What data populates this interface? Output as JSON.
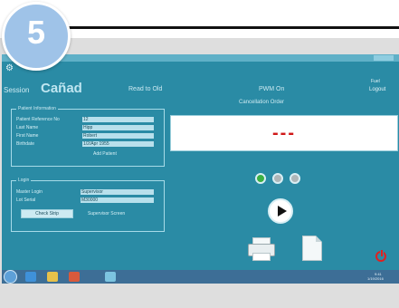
{
  "step": {
    "number": "5"
  },
  "app": {
    "title": "Cañad",
    "session_label": "Session",
    "header_center": "Read to Old",
    "header_right": "PWM On",
    "header_sub": "Cancellation Order",
    "logout_top": "Fuel",
    "logout_label": "Logout"
  },
  "patient_panel": {
    "title": "Patient Information",
    "fields": [
      {
        "label": "Patient Reference No",
        "value": "12"
      },
      {
        "label": "Last Name",
        "value": "Hipp"
      },
      {
        "label": "First Name",
        "value": "Robert"
      },
      {
        "label": "Birthdate",
        "value": "1/2/Apr 1955"
      }
    ],
    "note": "Add Patient"
  },
  "user_panel": {
    "title": "Login",
    "fields": [
      {
        "label": "Master Login",
        "value": "Supervisor"
      },
      {
        "label": "Lot Serial",
        "value": "M30000"
      }
    ],
    "button_label": "Check Strip",
    "side_note": "Supervisor Screen"
  },
  "display": {
    "value": "---"
  },
  "indicators": [
    {
      "state": "green",
      "color": "#3cb043"
    },
    {
      "state": "grey",
      "color": "#aeb6b8"
    },
    {
      "state": "grey",
      "color": "#aeb6b8"
    }
  ],
  "taskbar": {
    "tray_time": "9:41",
    "tray_date": "1/19/2016"
  }
}
